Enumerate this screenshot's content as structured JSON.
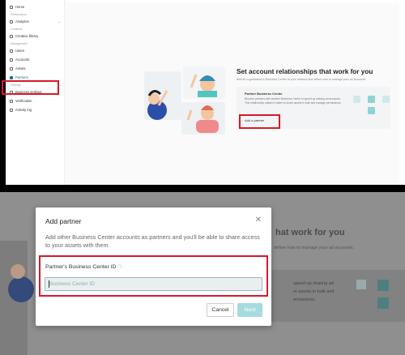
{
  "sidebar": {
    "items": [
      {
        "label": "Home",
        "section": ""
      },
      {
        "label": "Analytics",
        "section": "Performance"
      },
      {
        "label": "Creative library",
        "section": "Creatives"
      },
      {
        "label": "Users",
        "section": "Management"
      },
      {
        "label": "Accounts",
        "section": ""
      },
      {
        "label": "Assets",
        "section": ""
      },
      {
        "label": "Partners",
        "section": "",
        "active": true
      },
      {
        "label": "Business settings",
        "section": "Settings"
      },
      {
        "label": "Verification",
        "section": ""
      },
      {
        "label": "Activity log",
        "section": ""
      }
    ],
    "sections": {
      "performance": "Performance",
      "creatives": "Creatives",
      "management": "Management",
      "settings": "Settings"
    }
  },
  "main": {
    "title": "Set account relationships that work for you",
    "subtitle": "Add an organization's Business Center to your network and define how to manage your ad accounts.",
    "card": {
      "title": "Partner Business Center",
      "description": "Become partners with another Business Center to speed up sharing ad accounts. This relationship makes it easier to share assets in bulk and manage permissions.",
      "action": "Add a partner"
    }
  },
  "background": {
    "title": "hat work for you",
    "subtitle": "define how to manage your ad accounts.",
    "line1": "speed up sharing ad",
    "line2": "re assets in bulk and",
    "line3": "ermissions."
  },
  "modal": {
    "title": "Add partner",
    "description": "Add other Business Center accounts as partners and you'll be able to share access to your assets with them.",
    "field_label": "Partner's Business Center ID",
    "field_placeholder": "Business Center ID",
    "cancel": "Cancel",
    "next": "Next"
  },
  "colors": {
    "accent": "#0a7c86",
    "highlight": "#d7192b",
    "next_disabled": "#a6dbdf"
  }
}
